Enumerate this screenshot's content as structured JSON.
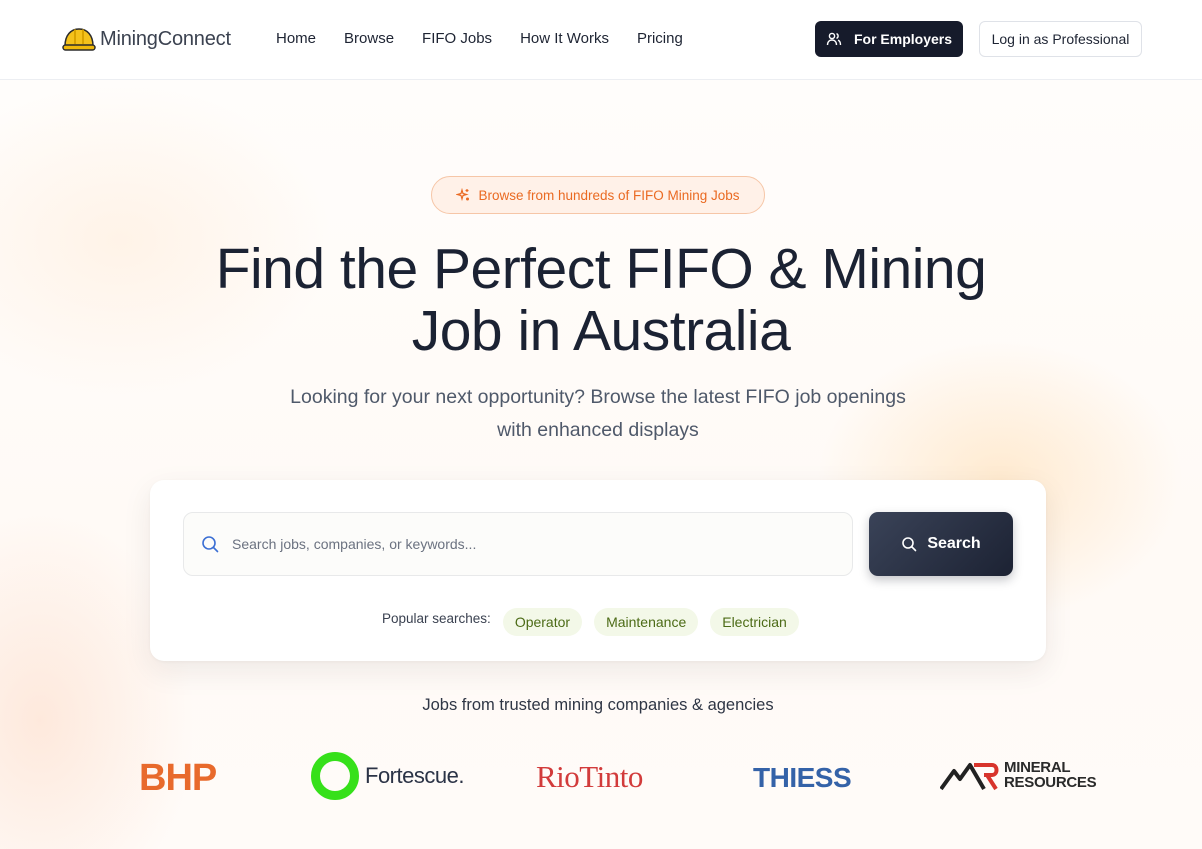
{
  "header": {
    "brand": "MiningConnect",
    "nav": [
      "Home",
      "Browse",
      "FIFO Jobs",
      "How It Works",
      "Pricing"
    ],
    "employers_label": "For Employers",
    "login_label": "Log in as Professional"
  },
  "hero": {
    "badge": "Browse from hundreds of FIFO Mining Jobs",
    "headline_line1": "Find the Perfect FIFO & Mining",
    "headline_line2": "Job in Australia",
    "subtitle": "Looking for your next opportunity? Browse the latest FIFO job openings with enhanced displays"
  },
  "search": {
    "placeholder": "Search jobs, companies, or keywords...",
    "button_label": "Search",
    "popular_label": "Popular searches:",
    "popular": [
      "Operator",
      "Maintenance",
      "Electrician"
    ]
  },
  "trusted": {
    "heading": "Jobs from trusted mining companies & agencies",
    "companies": [
      "BHP",
      "Fortescue.",
      "RioTinto",
      "THIESS",
      "MINERAL",
      "RESOURCES"
    ]
  },
  "colors": {
    "brand_dark": "#161b2b",
    "accent_orange": "#ea6a22",
    "chip_green": "#4c6b16",
    "bhp": "#e86a2c",
    "fortescue": "#36e01a",
    "riotinto": "#d23b3b",
    "thiess": "#3462a8"
  }
}
